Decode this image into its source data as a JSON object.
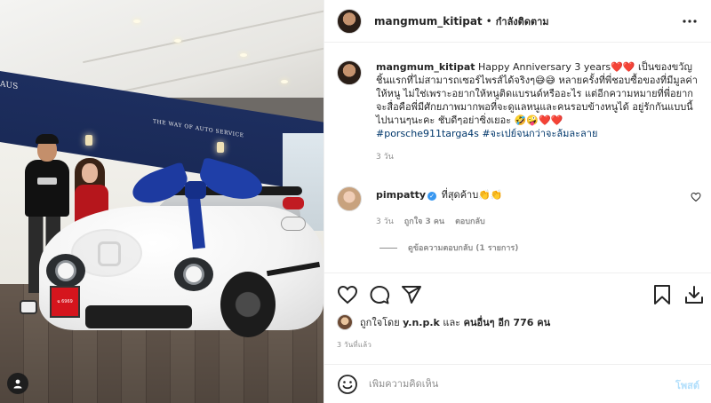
{
  "colors": {
    "accent_link": "#00376b",
    "verified_blue": "#3897f0",
    "post_disabled": "#b2dffc",
    "muted_text": "#8e8e8e",
    "heart_red": "#ed2c2c"
  },
  "photo": {
    "sign_left": "AUS",
    "sign_center": "THE WAY OF AUTO SERVICE",
    "plate": "ฉ 6969"
  },
  "header": {
    "username": "mangmum_kitipat",
    "separator": "•",
    "follow_status": "กำลังติดตาม",
    "more_icon": "more-horizontal-icon"
  },
  "caption": {
    "username": "mangmum_kitipat",
    "text_1": "Happy Anniversary 3 years",
    "hearts_1": "❤️❤️",
    "text_2": " เป็นของขวัญชิ้นแรกที่ไม่สามารถเซอร์ไพรส์ได้จริงๆ",
    "emoji_2": "😅😅",
    "text_3": " หลายครั้งที่พี่ชอบซื้อของที่มีมูลค่าให้หนู ไม่ใช่เพราะอยากให้หนูติดแบรนด์หรืออะไร แต่อีกความหมายที่พี่อยากจะสื่อคือพี่มีศักยภาพมากพอที่จะดูแลหนูและคนรอบข้างหนูได้ อยู่รักกันแบบนี้ไปนานๆนะคะ ชับดีๆอย่าซิ่งเยอะ",
    "emoji_3": "🤣🤪",
    "hearts_3": "❤️❤️",
    "hashtag_1": "#porsche911targa4s",
    "hashtag_2": "#จะเปย์จนกว่าจะล้มละลาย",
    "time": "3 วัน"
  },
  "reply": {
    "username": "pimpatty",
    "verified_mark": "✓",
    "text": "ที่สุดค้าบ",
    "emoji": "👏👏",
    "time": "3 วัน",
    "likes": "ถูกใจ 3 คน",
    "reply_link": "ตอบกลับ",
    "view_replies": "ดูข้อความตอบกลับ (1 รายการ)"
  },
  "actions": {
    "like_icon": "heart-icon",
    "comment_icon": "comment-icon",
    "share_icon": "share-icon",
    "save_icon": "bookmark-icon",
    "download_icon": "download-icon"
  },
  "likes": {
    "prefix": "ถูกใจโดย ",
    "liker": "y.n.p.k",
    "middle": " และ ",
    "others": "คนอื่นๆ อีก 776 คน"
  },
  "post_time": "3 วันที่แล้ว",
  "comment_box": {
    "placeholder": "เพิ่มความคิดเห็น",
    "post_label": "โพสต์",
    "emoji_icon": "emoji-smile-icon"
  }
}
